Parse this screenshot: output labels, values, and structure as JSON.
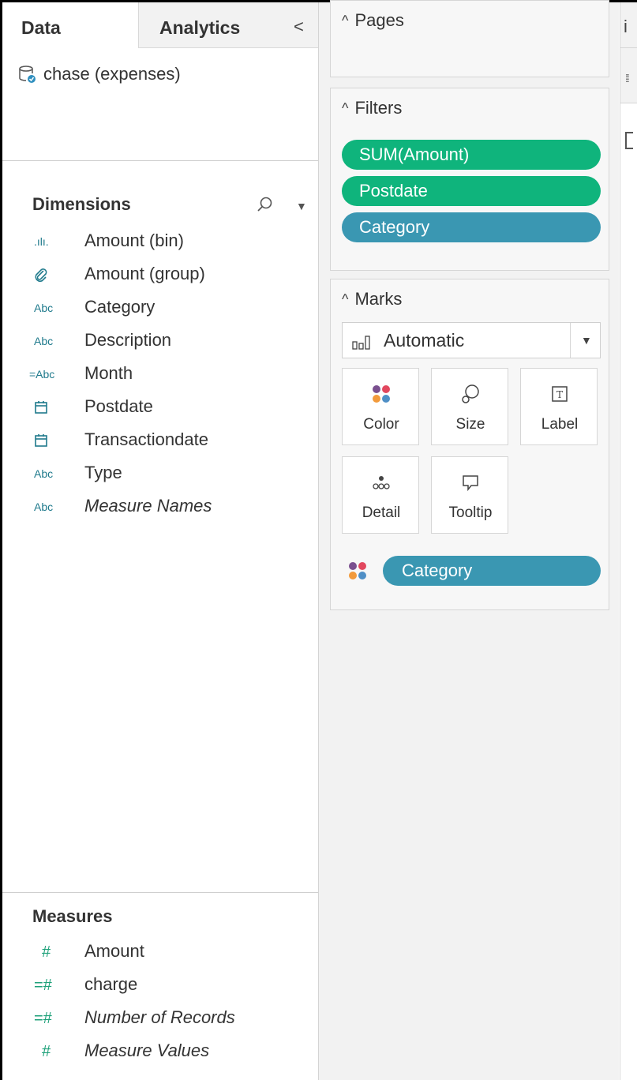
{
  "tabs": {
    "data": "Data",
    "analytics": "Analytics",
    "collapse": "<"
  },
  "datasource": {
    "name": "chase (expenses)"
  },
  "dimensions": {
    "title": "Dimensions",
    "items": [
      {
        "icon": "bin-icon",
        "glyph": ".ılı.",
        "label": "Amount (bin)",
        "italic": false
      },
      {
        "icon": "paperclip-icon",
        "glyph": "",
        "label": "Amount (group)",
        "italic": false
      },
      {
        "icon": "abc-icon",
        "glyph": "Abc",
        "label": "Category",
        "italic": false
      },
      {
        "icon": "abc-icon",
        "glyph": "Abc",
        "label": "Description",
        "italic": false
      },
      {
        "icon": "calc-abc-icon",
        "glyph": "=Abc",
        "label": "Month",
        "italic": false
      },
      {
        "icon": "calendar-icon",
        "glyph": "",
        "label": "Postdate",
        "italic": false
      },
      {
        "icon": "calendar-icon",
        "glyph": "",
        "label": "Transactiondate",
        "italic": false
      },
      {
        "icon": "abc-icon",
        "glyph": "Abc",
        "label": "Type",
        "italic": false
      },
      {
        "icon": "abc-icon",
        "glyph": "Abc",
        "label": "Measure Names",
        "italic": true
      }
    ]
  },
  "measures": {
    "title": "Measures",
    "items": [
      {
        "icon": "number-icon",
        "glyph": "#",
        "label": "Amount",
        "italic": false
      },
      {
        "icon": "calc-number-icon",
        "glyph": "=#",
        "label": "charge",
        "italic": false
      },
      {
        "icon": "calc-number-icon",
        "glyph": "=#",
        "label": "Number of Records",
        "italic": true
      },
      {
        "icon": "number-icon",
        "glyph": "#",
        "label": "Measure Values",
        "italic": true
      }
    ]
  },
  "pages": {
    "title": "Pages"
  },
  "filters": {
    "title": "Filters",
    "pills": [
      "SUM(Amount)",
      "Postdate",
      "Category"
    ]
  },
  "marks": {
    "title": "Marks",
    "type": "Automatic",
    "buttons": [
      "Color",
      "Size",
      "Label",
      "Detail",
      "Tooltip"
    ],
    "color_pill": "Category"
  },
  "right_panel": {
    "top_glyph": "i"
  },
  "colors": {
    "green_pill": "#0fb47c",
    "teal_pill": "#3a97b2",
    "icon_teal": "#1f7a8c",
    "icon_green": "#1fa17a"
  }
}
